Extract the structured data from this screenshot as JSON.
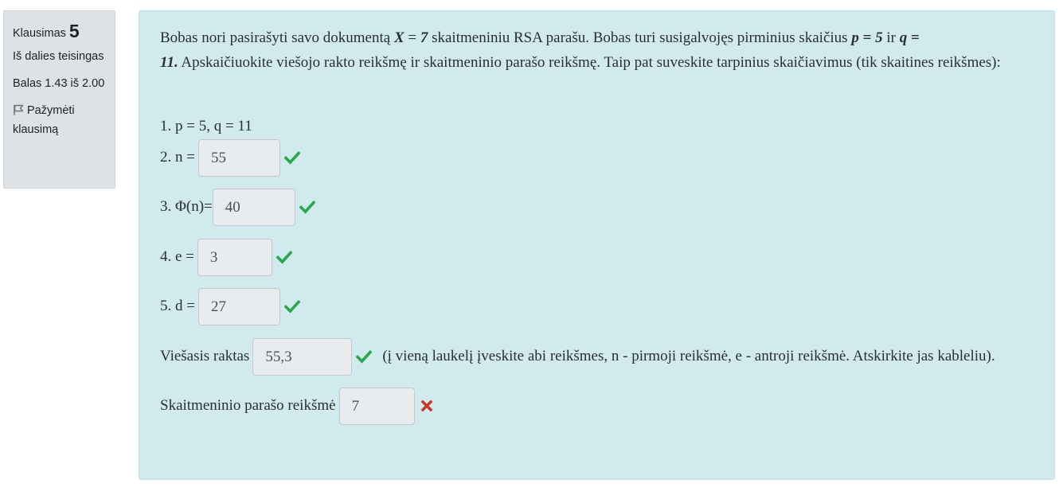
{
  "info": {
    "question_label": "Klausimas",
    "question_number": "5",
    "state": "Iš dalies teisingas",
    "grade": "Balas 1.43 iš 2.00",
    "flag_label": "Pažymėti klausimą"
  },
  "question": {
    "intro_1": "Bobas nori pasirašyti savo dokumentą ",
    "X": "X",
    "eq1": " = ",
    "X_val": "7",
    "intro_2": " skaitmeniniu RSA parašu. Bobas turi susigalvojęs pirminius skaičius ",
    "p": "p",
    "eq2": " = ",
    "p_val": "5",
    "ir": " ir ",
    "q": "q",
    "eq3": " = ",
    "q_val": "11.",
    "intro_3": " Apskaičiuokite viešojo rakto reikšmę ir skaitmeninio parašo reikšmę. Taip pat suveskite tarpinius skaičiavimus (tik skaitines reikšmes):"
  },
  "steps": {
    "s1": "1. p = 5, q = 11",
    "s2_label": "2. n =",
    "s2_value": "55",
    "s3_label": "3. Φ(n)=",
    "s3_value": "40",
    "s4_label": "4. e =",
    "s4_value": "3",
    "s5_label": "5. d =",
    "s5_value": "27",
    "public_key_label": "Viešasis raktas",
    "public_key_value": "55,3",
    "public_key_hint": "(į vieną laukelį įveskite abi reikšmes, n - pirmoji reikšmė, e - antroji reikšmė. Atskirkite jas kableliu).",
    "signature_label": "Skaitmeninio parašo reikšmė",
    "signature_value": "7"
  },
  "colors": {
    "correct": "#2aa748",
    "incorrect": "#ca3120"
  }
}
